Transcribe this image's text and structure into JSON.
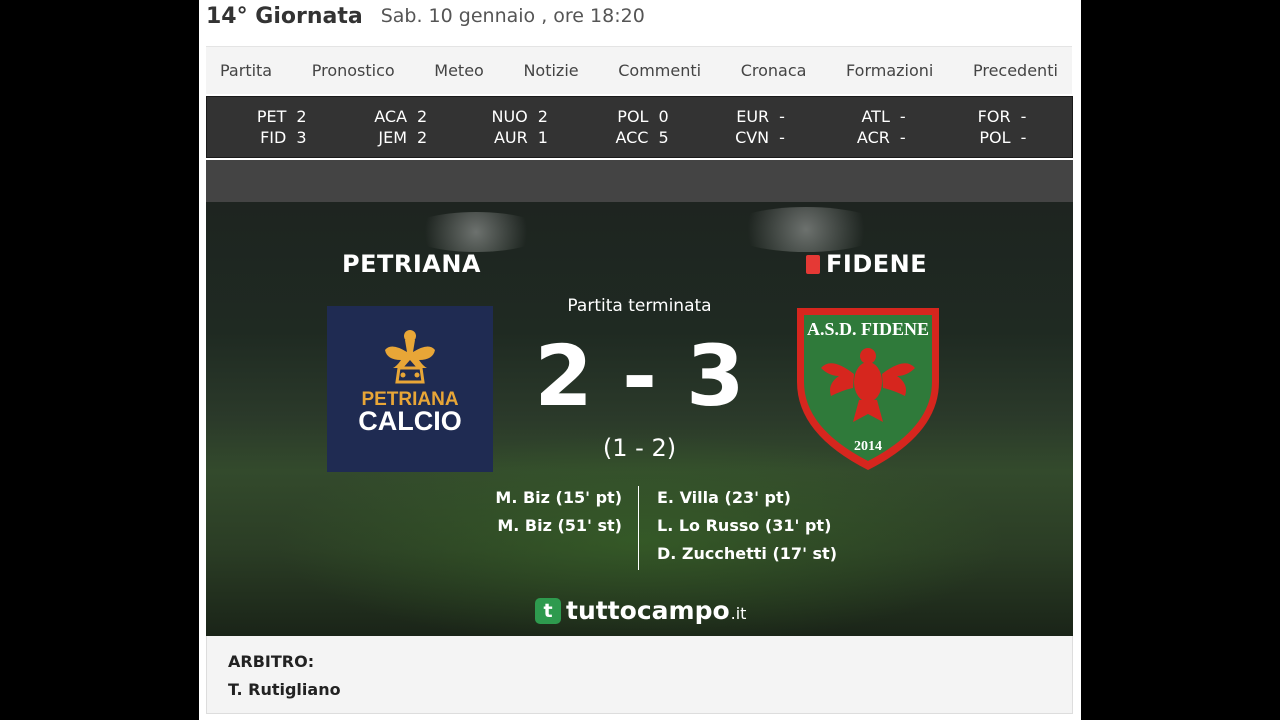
{
  "header": {
    "round": "14° Giornata",
    "date": "Sab. 10 gennaio , ore 18:20"
  },
  "tabs": [
    "Partita",
    "Pronostico",
    "Meteo",
    "Notizie",
    "Commenti",
    "Cronaca",
    "Formazioni",
    "Precedenti"
  ],
  "other_matches": [
    {
      "home": "PET",
      "home_score": "2",
      "away": "FID",
      "away_score": "3"
    },
    {
      "home": "ACA",
      "home_score": "2",
      "away": "JEM",
      "away_score": "2"
    },
    {
      "home": "NUO",
      "home_score": "2",
      "away": "AUR",
      "away_score": "1"
    },
    {
      "home": "POL",
      "home_score": "0",
      "away": "ACC",
      "away_score": "5"
    },
    {
      "home": "EUR",
      "home_score": "-",
      "away": "CVN",
      "away_score": "-"
    },
    {
      "home": "ATL",
      "home_score": "-",
      "away": "ACR",
      "away_score": "-"
    },
    {
      "home": "FOR",
      "home_score": "-",
      "away": "POL",
      "away_score": "-"
    }
  ],
  "match": {
    "home_team": "PETRIANA",
    "away_team": "FIDENE",
    "status": "Partita terminata",
    "score": "2 - 3",
    "half_time": "(1 - 2)",
    "home_logo_top": "PETRIANA",
    "home_logo_bottom": "CALCIO",
    "away_logo_top": "A.S.D. FIDENE",
    "away_logo_year": "2014",
    "home_scorers": [
      "M. Biz (15' pt)",
      "M. Biz (51' st)"
    ],
    "away_scorers": [
      "E. Villa (23' pt)",
      "L. Lo Russo (31' pt)",
      "D. Zucchetti (17' st)"
    ],
    "away_red_card_icon": "red-card-icon"
  },
  "brand": {
    "badge": "t",
    "name": "tuttocampo",
    "tld": ".it"
  },
  "referee": {
    "label": "ARBITRO:",
    "name": "T. Rutigliano"
  },
  "colors": {
    "page_bg": "#ffffff",
    "scorebar_bg": "#333333",
    "home_logo_bg": "#1f2b52",
    "home_logo_gold": "#e8a637",
    "away_logo_green": "#2f7a3a",
    "away_logo_red": "#d6261e",
    "brand_green": "#2e9a4e",
    "red_card": "#e53935"
  }
}
